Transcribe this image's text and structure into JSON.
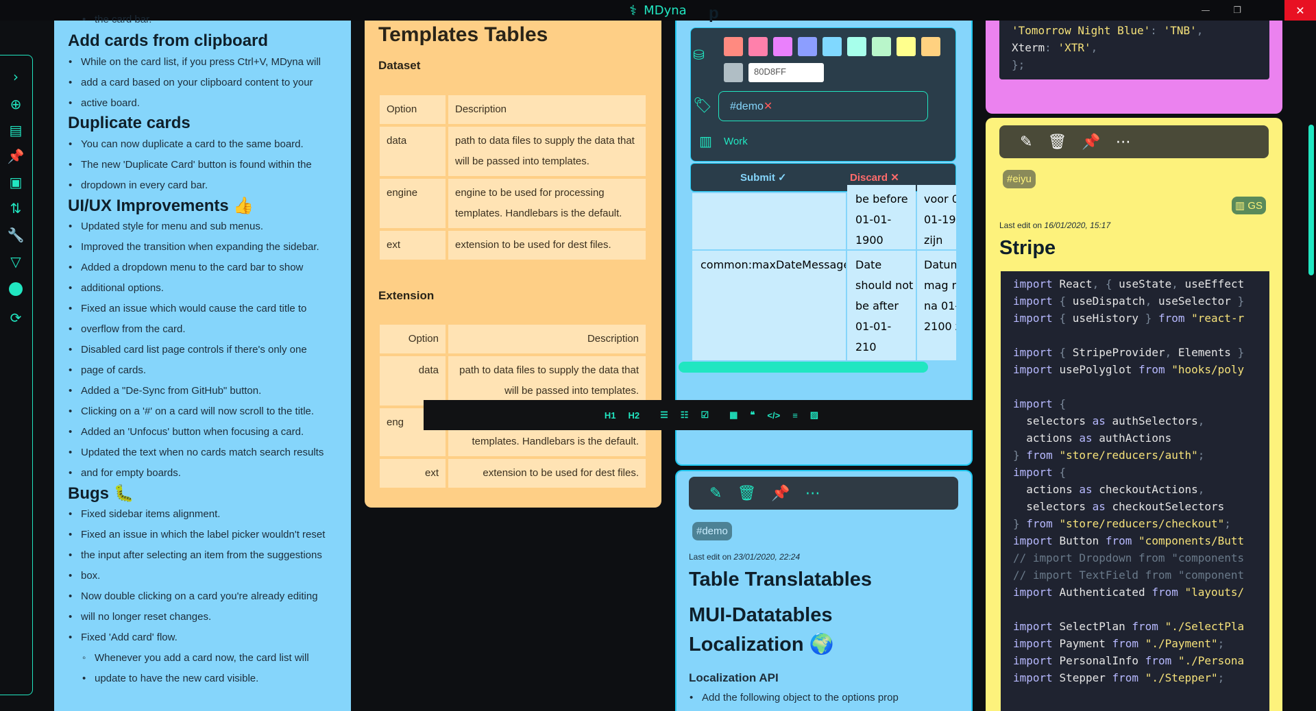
{
  "app": {
    "title": "MDyna",
    "logo_icon": "dna-icon"
  },
  "window": {
    "minimize": "—",
    "maximize": "❐",
    "close": "✕"
  },
  "colors": {
    "accent": "#21e6c1",
    "blue_card": "#85d5fb",
    "orange_card": "#fecf86",
    "pink_card": "#eb82ef",
    "yellow_card": "#fdf27c"
  },
  "sidebar": {
    "items": [
      {
        "icon": "expand-icon",
        "glyph": "›"
      },
      {
        "icon": "add-card-icon",
        "glyph": "⊕"
      },
      {
        "icon": "boards-icon",
        "glyph": "▤"
      },
      {
        "icon": "pin-icon",
        "glyph": "✎"
      },
      {
        "icon": "archive-icon",
        "glyph": "▣"
      },
      {
        "icon": "sort-icon",
        "glyph": "⇅"
      },
      {
        "icon": "settings-wrench-icon",
        "glyph": "✦"
      },
      {
        "icon": "filter-icon",
        "glyph": "▽"
      },
      {
        "icon": "github-icon",
        "glyph": ""
      },
      {
        "icon": "sync-icon",
        "glyph": "⟳"
      }
    ]
  },
  "changelog": {
    "cut_text": "the card bar.",
    "sections": [
      {
        "title": "Add cards from clipboard",
        "items": [
          "While on the card list, if you press Ctrl+V, MDyna will",
          "add a card based on your clipboard content to your",
          "active board."
        ]
      },
      {
        "title": "Duplicate cards",
        "items": [
          "You can now duplicate a card to the same board.",
          "The new 'Duplicate Card' button is found within the",
          "dropdown in every card bar."
        ]
      },
      {
        "title": "UI/UX Improvements",
        "emoji": "👍",
        "items": [
          "Updated style for menu and sub menus.",
          "Improved the transition when expanding the sidebar.",
          "Added a dropdown menu to the card bar to show",
          "additional options.",
          "Fixed an issue which would cause the card title to",
          "overflow from the card.",
          "Disabled card list page controls if there's only one",
          "page of cards.",
          "Added a \"De-Sync from GitHub\" button.",
          "Clicking on a '#' on a card will now scroll to the title.",
          "Added an 'Unfocus' button when focusing a card.",
          "Updated the text when no cards match search results",
          "and for empty boards."
        ]
      },
      {
        "title": "Bugs",
        "emoji": "🐛",
        "items": [
          "Fixed sidebar items alignment.",
          "Fixed an issue in which the label picker wouldn't reset",
          "the input after selecting an item from the suggestions",
          "box.",
          "Now double clicking on a card you're already editing",
          "will no longer reset changes.",
          "Fixed 'Add card' flow.",
          "Whenever you add a card now, the card list will",
          "update to have the new card visible."
        ]
      }
    ]
  },
  "templates": {
    "title": "Templates Tables",
    "dataset_heading": "Dataset",
    "extension_heading": "Extension",
    "header": [
      "Option",
      "Description"
    ],
    "rows": [
      [
        "data",
        "path to data files to supply the data that will be passed into templates."
      ],
      [
        "engine",
        "engine to be used for processing templates. Handlebars is the default."
      ],
      [
        "ext",
        "extension to be used for dest files."
      ]
    ],
    "ext_rows_partial": {
      "data": "data",
      "data_desc": "path to data files to supply the data that will be passed into templates.",
      "engine_cut": "eng",
      "engine_desc_cut": "templates. Handlebars is the default.",
      "ext": "ext",
      "ext_desc": "extension to be used for dest files."
    }
  },
  "editor": {
    "hex_value": "80D8FF",
    "swatches": [
      "#ff8a80",
      "#ff80ab",
      "#ea80fc",
      "#8c9eff",
      "#80d8ff",
      "#a7ffeb",
      "#b9f6ca",
      "#ffff8d",
      "#ffd180",
      "#b0bec5"
    ],
    "tag_value": "#demo",
    "tag_remove": "✕",
    "board_label": "Work",
    "submit": "Submit ✓",
    "discard": "Discard ✕",
    "partial_title": "p"
  },
  "translations_table": {
    "rows": [
      {
        "key": "",
        "en": "be before\n01-01-\n1900",
        "nl": "voor 0\n01-19\nzijn"
      },
      {
        "key": "common:maxDateMessage",
        "en": "Date\nshould not\nbe after\n01-01-\n210",
        "nl": "Datum\nmag n\nna 01-\n2100 z"
      }
    ]
  },
  "format_toolbar": [
    "H1",
    "H2",
    "☰",
    "☷",
    "☑",
    "▦",
    "❝",
    "</>",
    "≡",
    "▨"
  ],
  "demo_card": {
    "tag": "#demo",
    "last_edit_label": "Last edit on",
    "last_edit_date": "23/01/2020, 22:24",
    "title1": "Table Translatables",
    "title2": "MUI-Datatables",
    "title3": "Localization",
    "emoji": "🌍",
    "subheading": "Localization API",
    "bullet": "Add the following object to the options prop"
  },
  "theme_code": {
    "line1_key": "'Tomorrow Night Blue'",
    "line1_val": "'TNB'",
    "line2_key": "Xterm",
    "line2_val": "'XTR'",
    "line3": "};"
  },
  "stripe_card": {
    "tag": "#eiyu",
    "board_badge": "GS",
    "last_edit_label": "Last edit on",
    "last_edit_date": "16/01/2020, 15:17",
    "title": "Stripe",
    "code": [
      "import React, { useState, useEffect",
      "import { useDispatch, useSelector }",
      "import { useHistory } from \"react-r",
      "",
      "import { StripeProvider, Elements }",
      "import usePolyglot from \"hooks/poly",
      "",
      "import {",
      "  selectors as authSelectors,",
      "  actions as authActions",
      "} from \"store/reducers/auth\";",
      "import {",
      "  actions as checkoutActions,",
      "  selectors as checkoutSelectors",
      "} from \"store/reducers/checkout\";",
      "import Button from \"components/Butt",
      "// import Dropdown from \"components",
      "// import TextField from \"component",
      "import Authenticated from \"layouts/",
      "",
      "import SelectPlan from \"./SelectPla",
      "import Payment from \"./Payment\";",
      "import PersonalInfo from \"./Persona",
      "import Stepper from \"./Stepper\";"
    ]
  }
}
